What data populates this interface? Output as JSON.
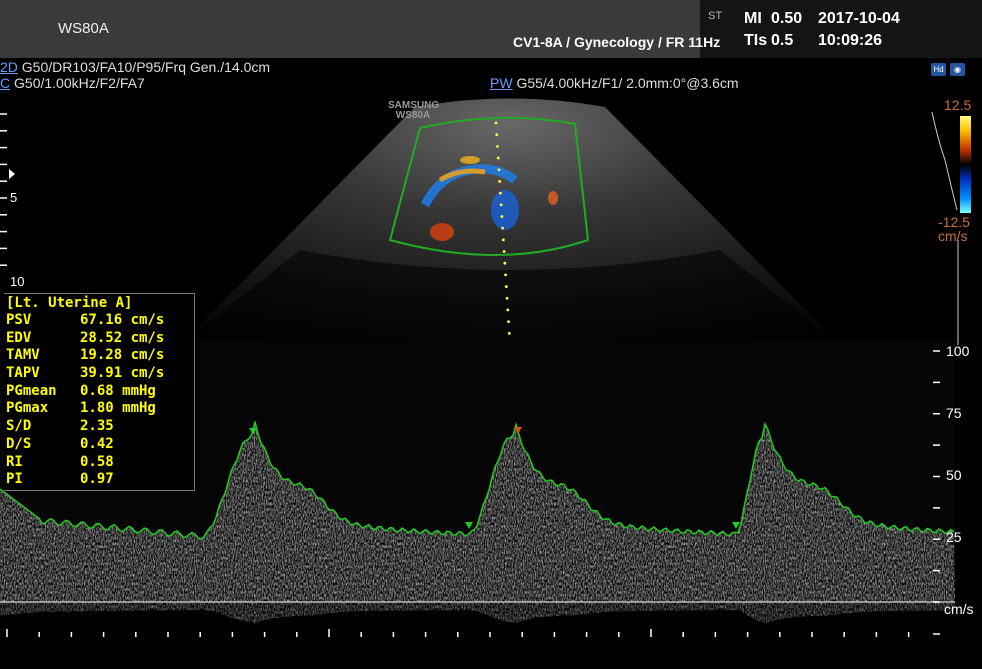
{
  "header": {
    "brand": "WS80A",
    "partial_left": "ST",
    "mi_label": "MI",
    "mi_value": "0.50",
    "tis_label": "TIs",
    "tis_value": "0.5",
    "date": "2017-10-04",
    "time": "10:09:26",
    "probe_preset": "CV1-8A / Gynecology / FR 11Hz"
  },
  "params": {
    "mode_2d": "2D",
    "params_2d": "G50/DR103/FA10/P95/Frq Gen./14.0cm",
    "mode_c": "C",
    "params_c": "G50/1.00kHz/F2/FA7",
    "mode_pw": "PW",
    "params_pw": "G55/4.00kHz/F1/ 2.0mm:0°@3.6cm"
  },
  "image": {
    "watermark_line1": "SAMSUNG",
    "watermark_line2": "WS80A"
  },
  "depth_scale": {
    "label_5": "5",
    "label_10": "10"
  },
  "color_bar": {
    "max": "12.5",
    "min": "-12.5",
    "unit": "cm/s"
  },
  "velocity_scale": {
    "labels": [
      "100",
      "75",
      "50",
      "25"
    ],
    "unit": "cm/s"
  },
  "measurements": {
    "title": "[Lt. Uterine A]",
    "rows": [
      {
        "label": "PSV",
        "value": "67.16 cm/s"
      },
      {
        "label": "EDV",
        "value": "28.52 cm/s"
      },
      {
        "label": "TAMV",
        "value": "19.28 cm/s"
      },
      {
        "label": "TAPV",
        "value": "39.91 cm/s"
      },
      {
        "label": "PGmean",
        "value": "0.68 mmHg"
      },
      {
        "label": "PGmax",
        "value": "1.80 mmHg"
      },
      {
        "label": "S/D",
        "value": "2.35"
      },
      {
        "label": "D/S",
        "value": "0.42"
      },
      {
        "label": "RI",
        "value": "0.58"
      },
      {
        "label": "PI",
        "value": "0.97"
      }
    ]
  },
  "icons": [
    "hdr-icon",
    "camera-icon"
  ],
  "colors": {
    "measurement_text": "#ffff00",
    "sector_outline": "#22aa22",
    "doppler_trace": "#22cc22",
    "mode_link": "#6a9cff",
    "color_bar_label": "#c87033"
  }
}
